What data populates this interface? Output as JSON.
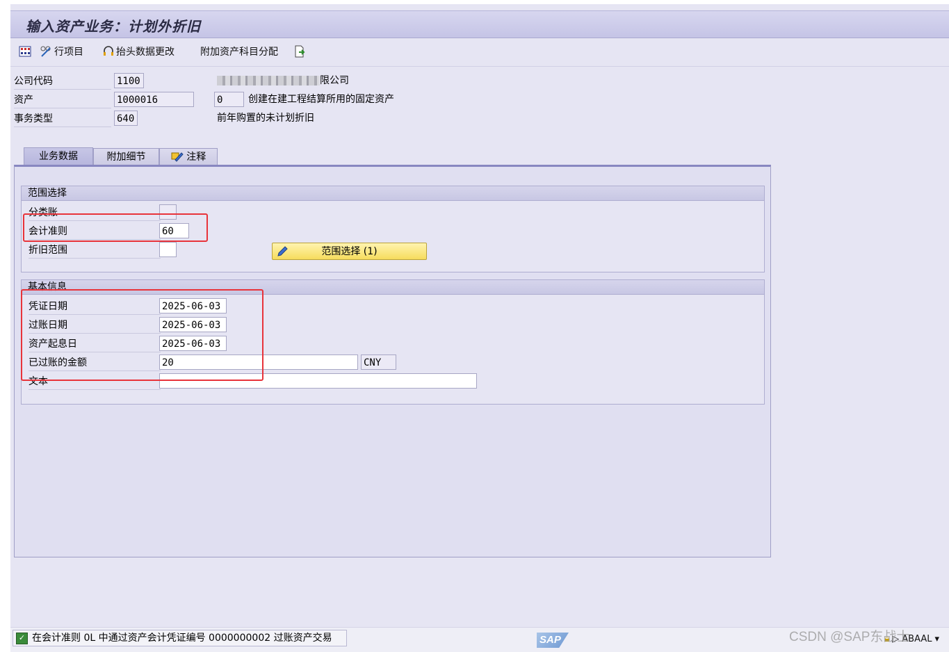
{
  "window": {
    "title": "输入资产业务：计划外折旧"
  },
  "toolbar": {
    "item1_label": "行项目",
    "item2_label": "抬头数据更改",
    "item3_label": "附加资产科目分配"
  },
  "header": {
    "company_code_label": "公司代码",
    "company_code_value": "1100",
    "company_name_suffix": "限公司",
    "asset_label": "资产",
    "asset_value": "1000016",
    "asset_sub_value": "0",
    "asset_desc": "创建在建工程结算所用的固定资产",
    "trans_type_label": "事务类型",
    "trans_type_value": "640",
    "trans_type_desc": "前年购置的未计划折旧"
  },
  "tabs": [
    {
      "label": "业务数据"
    },
    {
      "label": "附加细节"
    },
    {
      "label": "注释"
    }
  ],
  "scope_group": {
    "title": "范围选择",
    "ledger_label": "分类账",
    "ledger_value": "",
    "accounting_principle_label": "会计准则",
    "accounting_principle_value": "60",
    "dep_area_label": "折旧范围",
    "dep_area_value": "",
    "button_label": "范围选择 (1)"
  },
  "basic_group": {
    "title": "基本信息",
    "doc_date_label": "凭证日期",
    "doc_date_value": "2025-06-03",
    "posting_date_label": "过账日期",
    "posting_date_value": "2025-06-03",
    "asset_value_date_label": "资产起息日",
    "asset_value_date_value": "2025-06-03",
    "amount_label": "已过账的金额",
    "amount_value": "20",
    "currency_value": "CNY",
    "text_label": "文本",
    "text_value": ""
  },
  "statusbar": {
    "message": "在会计准则 0L 中通过资产会计凭证编号 0000000002 过账资产交易",
    "logo": "SAP",
    "system": "ABAAL"
  },
  "watermark": "CSDN @SAP东战士",
  "colors": {
    "highlight": "#e8333a",
    "button": "#f6dc5d",
    "background": "#e6e5f3"
  }
}
